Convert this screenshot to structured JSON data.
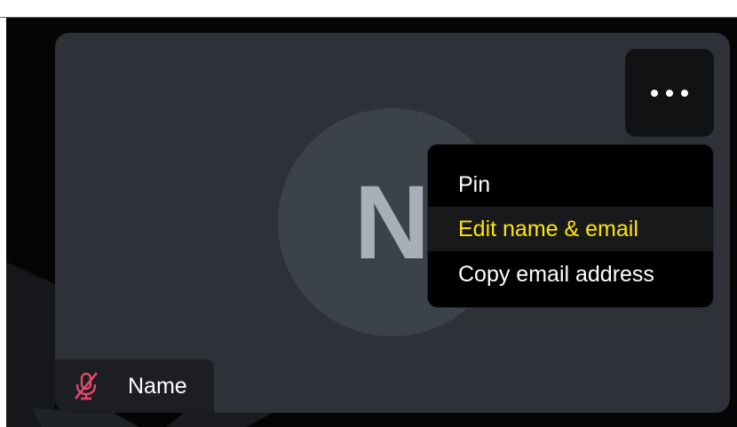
{
  "participant": {
    "avatar_initial": "N",
    "name": "Name",
    "mic_status_icon": "mic-off-icon"
  },
  "more_button": {
    "icon": "more-horizontal-icon"
  },
  "context_menu": {
    "items": [
      {
        "label": "Pin"
      },
      {
        "label": "Edit name & email"
      },
      {
        "label": "Copy email address"
      }
    ],
    "highlighted_index": 1,
    "highlight_color": "#ffe600"
  },
  "colors": {
    "tile_background": "#2e3238",
    "menu_background": "#000000",
    "mic_muted": "#e0476b"
  }
}
